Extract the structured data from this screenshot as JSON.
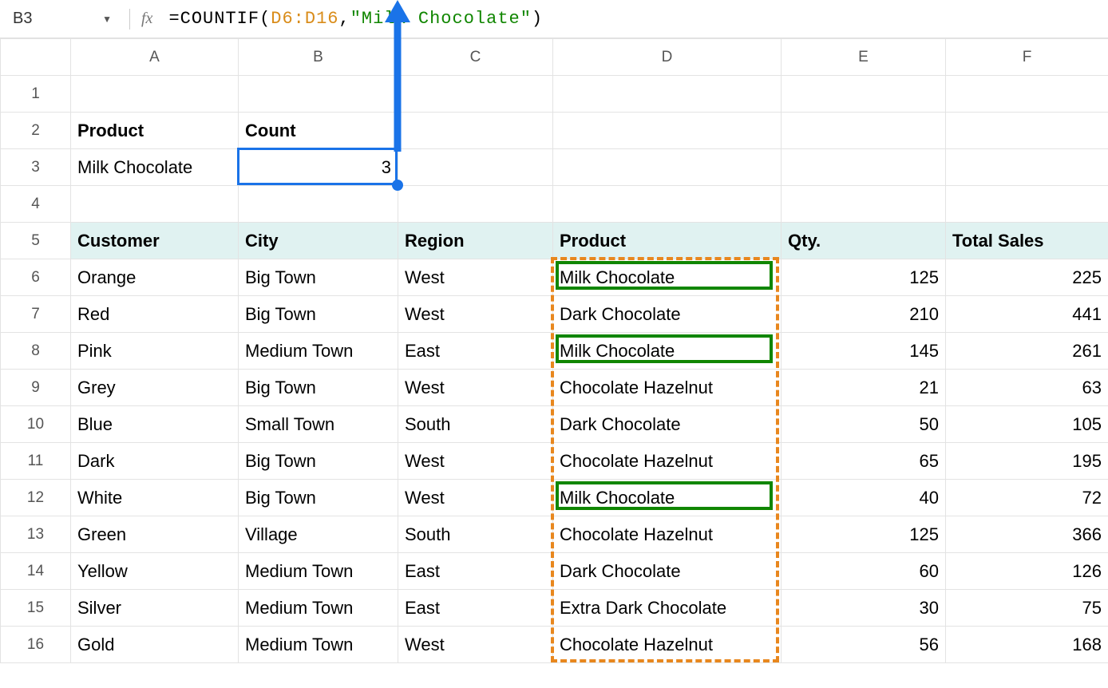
{
  "name_box": "B3",
  "formula": {
    "eq": "=",
    "fn": "COUNTIF",
    "open": "(",
    "ref": "D6:D16",
    "comma": ",",
    "str": "\"Milk Chocolate\"",
    "close": ")"
  },
  "columns": [
    "A",
    "B",
    "C",
    "D",
    "E",
    "F"
  ],
  "row_headers": [
    "1",
    "2",
    "3",
    "4",
    "5",
    "6",
    "7",
    "8",
    "9",
    "10",
    "11",
    "12",
    "13",
    "14",
    "15",
    "16"
  ],
  "summary": {
    "product_label": "Product",
    "count_label": "Count",
    "product_value": "Milk Chocolate",
    "count_value": "3"
  },
  "table": {
    "headers": {
      "customer": "Customer",
      "city": "City",
      "region": "Region",
      "product": "Product",
      "qty": "Qty.",
      "total": "Total Sales"
    },
    "rows": [
      {
        "customer": "Orange",
        "city": "Big Town",
        "region": "West",
        "product": "Milk Chocolate",
        "qty": "125",
        "total": "225",
        "match": true
      },
      {
        "customer": "Red",
        "city": "Big Town",
        "region": "West",
        "product": "Dark Chocolate",
        "qty": "210",
        "total": "441",
        "match": false
      },
      {
        "customer": "Pink",
        "city": "Medium Town",
        "region": "East",
        "product": "Milk Chocolate",
        "qty": "145",
        "total": "261",
        "match": true
      },
      {
        "customer": "Grey",
        "city": "Big Town",
        "region": "West",
        "product": "Chocolate Hazelnut",
        "qty": "21",
        "total": "63",
        "match": false
      },
      {
        "customer": "Blue",
        "city": "Small Town",
        "region": "South",
        "product": "Dark Chocolate",
        "qty": "50",
        "total": "105",
        "match": false
      },
      {
        "customer": "Dark",
        "city": "Big Town",
        "region": "West",
        "product": "Chocolate Hazelnut",
        "qty": "65",
        "total": "195",
        "match": false
      },
      {
        "customer": "White",
        "city": "Big Town",
        "region": "West",
        "product": "Milk Chocolate",
        "qty": "40",
        "total": "72",
        "match": true
      },
      {
        "customer": "Green",
        "city": "Village",
        "region": "South",
        "product": "Chocolate Hazelnut",
        "qty": "125",
        "total": "366",
        "match": false
      },
      {
        "customer": "Yellow",
        "city": "Medium Town",
        "region": "East",
        "product": "Dark Chocolate",
        "qty": "60",
        "total": "126",
        "match": false
      },
      {
        "customer": "Silver",
        "city": "Medium Town",
        "region": "East",
        "product": "Extra Dark Chocolate",
        "qty": "30",
        "total": "75",
        "match": false
      },
      {
        "customer": "Gold",
        "city": "Medium Town",
        "region": "West",
        "product": "Chocolate Hazelnut",
        "qty": "56",
        "total": "168",
        "match": false
      }
    ]
  }
}
